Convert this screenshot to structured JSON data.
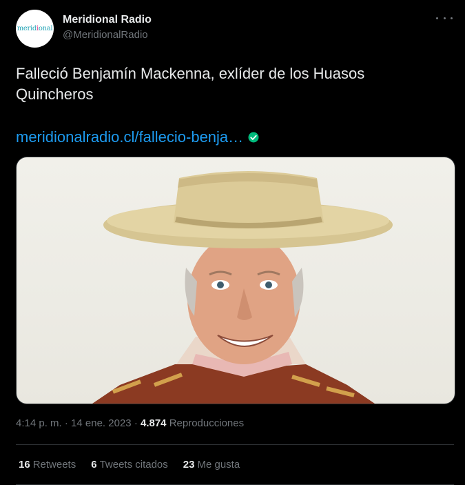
{
  "tweet": {
    "display_name": "Meridional Radio",
    "handle": "@MeridionalRadio",
    "avatar_logo_text": "Meridional",
    "text": "Falleció Benjamín Mackenna, exlíder de los Huasos Quincheros",
    "link_text": "meridionalradio.cl/fallecio-benja…",
    "image_alt": "Retrato de Benjamín Mackenna con sombrero de huaso",
    "time": "4:14 p. m.",
    "separator": "·",
    "date": "14 ene. 2023",
    "views_count": "4.874",
    "views_label": "Reproducciones"
  },
  "stats": {
    "retweets_count": "16",
    "retweets_label": "Retweets",
    "quotes_count": "6",
    "quotes_label": "Tweets citados",
    "likes_count": "23",
    "likes_label": "Me gusta"
  },
  "icons": {
    "more": "more-horizontal-icon",
    "verified": "verified-check-icon"
  },
  "colors": {
    "background": "#000000",
    "text_primary": "#e7e9ea",
    "text_secondary": "#71767b",
    "link": "#1d9bf0",
    "verified_badge": "#00ba7c",
    "divider": "#2f3336"
  }
}
